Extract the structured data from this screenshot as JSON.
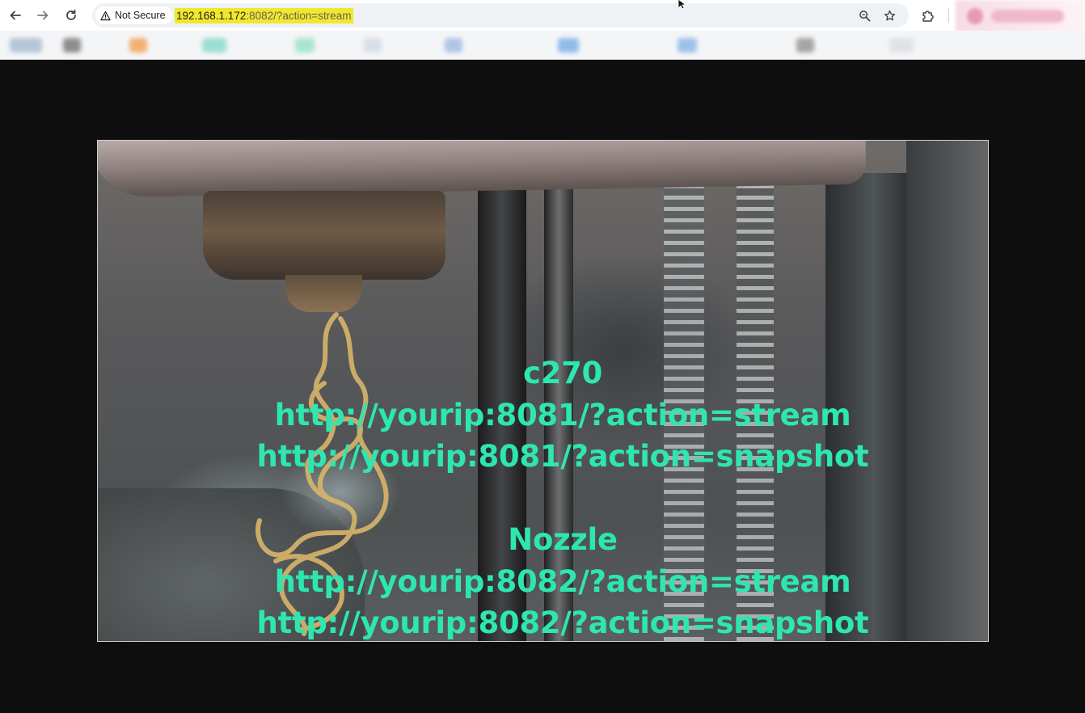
{
  "browser": {
    "security_label": "Not Secure",
    "url_host": "192.168.1.172",
    "url_rest": ":8082/?action=stream",
    "icons": {
      "back": "arrow-left",
      "forward": "arrow-right",
      "reload": "reload",
      "warning": "warning-triangle",
      "zoom": "magnifier",
      "bookmark": "star",
      "extensions": "puzzle-piece"
    }
  },
  "stream": {
    "camera1": {
      "name": "c270",
      "stream_url": "http://yourip:8081/?action=stream",
      "snapshot_url": "http://yourip:8081/?action=snapshot"
    },
    "camera2": {
      "name": "Nozzle",
      "stream_url": "http://yourip:8082/?action=stream",
      "snapshot_url": "http://yourip:8082/?action=snapshot"
    },
    "text_color": "#2ee6b0"
  }
}
